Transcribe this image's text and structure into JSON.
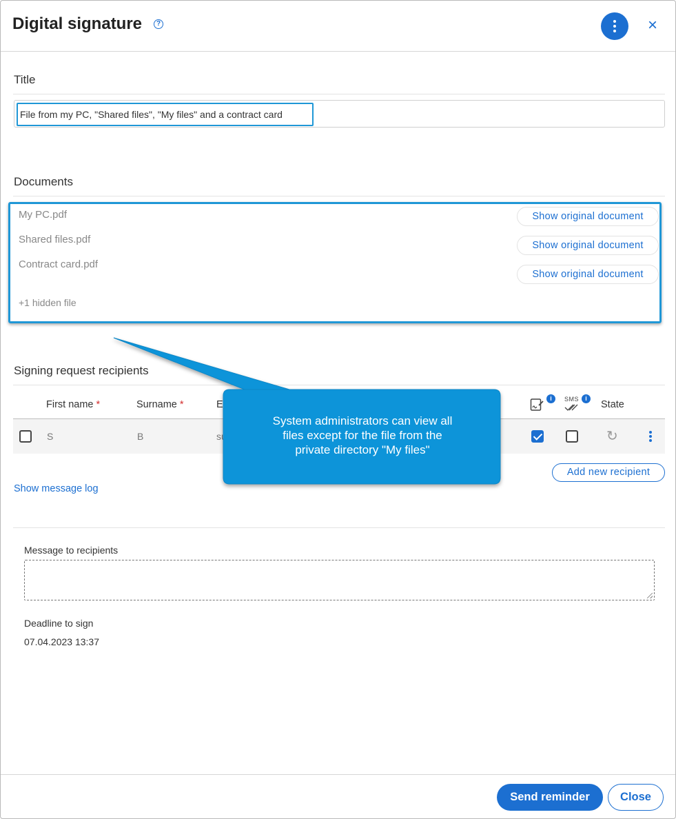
{
  "dialog": {
    "title": "Digital signature",
    "help_glyph": "?",
    "close_glyph": "×"
  },
  "title_section": {
    "label": "Title",
    "value": "File from my PC, \"Shared files\", \"My files\" and a contract card"
  },
  "documents": {
    "label": "Documents",
    "items": [
      {
        "name": "My PC.pdf",
        "action": "Show original document"
      },
      {
        "name": "Shared files.pdf",
        "action": "Show original document"
      },
      {
        "name": "Contract card.pdf",
        "action": "Show original document"
      }
    ],
    "hidden_note": "+1 hidden file"
  },
  "recipients": {
    "label": "Signing request recipients",
    "columns": {
      "first_name": "First name",
      "surname": "Surname",
      "email_initial": "E",
      "required_mark": "*",
      "sms_label": "SMS",
      "info_glyph": "i",
      "state": "State"
    },
    "rows": [
      {
        "first_name": "S",
        "surname": "B",
        "email": "su",
        "sign_checked": true,
        "sms_checked": false
      }
    ],
    "show_log": "Show message log",
    "add_recipient": "Add new recipient"
  },
  "message": {
    "label": "Message to recipients",
    "value": ""
  },
  "deadline": {
    "label": "Deadline to sign",
    "value": "07.04.2023 13:37"
  },
  "footer": {
    "send_reminder": "Send reminder",
    "close": "Close"
  },
  "callout": {
    "line1": "System administrators can view all",
    "line2": "files except for the file from the",
    "line3": "private directory \"My files\""
  },
  "colors": {
    "primary": "#1c6fd1",
    "highlight": "#1f97d6",
    "callout_fill": "#0b94d9",
    "required": "#d32f2f"
  },
  "icons": [
    "help-icon",
    "kebab-menu-icon",
    "close-icon",
    "signature-icon",
    "sms-icon",
    "info-icon",
    "refresh-icon",
    "row-kebab-icon"
  ]
}
